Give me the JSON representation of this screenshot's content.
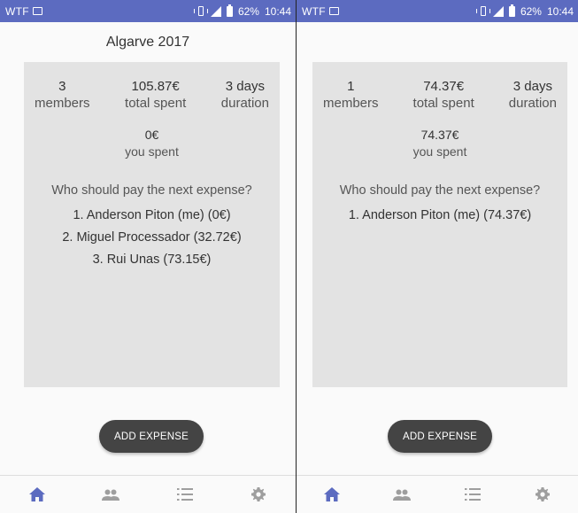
{
  "status_bar": {
    "carrier": "WTF",
    "battery": "62%",
    "time": "10:44"
  },
  "left_screen": {
    "title": "Algarve 2017",
    "stats": [
      {
        "value": "3",
        "label": "members"
      },
      {
        "value": "105.87€",
        "label": "total spent"
      },
      {
        "value": "3 days",
        "label": "duration"
      }
    ],
    "you_spent": {
      "value": "0€",
      "label": "you spent"
    },
    "question": "Who should pay the next expense?",
    "payers": [
      "1. Anderson Piton (me) (0€)",
      "2. Miguel Processador (32.72€)",
      "3. Rui Unas (73.15€)"
    ],
    "add_button": "ADD EXPENSE"
  },
  "right_screen": {
    "title": "",
    "stats": [
      {
        "value": "1",
        "label": "members"
      },
      {
        "value": "74.37€",
        "label": "total spent"
      },
      {
        "value": "3 days",
        "label": "duration"
      }
    ],
    "you_spent": {
      "value": "74.37€",
      "label": "you spent"
    },
    "question": "Who should pay the next expense?",
    "payers": [
      "1. Anderson Piton (me) (74.37€)"
    ],
    "add_button": "ADD EXPENSE"
  },
  "bottom_nav": {
    "items": [
      "home-icon",
      "people-icon",
      "list-icon",
      "settings-icon"
    ],
    "active_color": "#5c6bc0",
    "inactive_color": "#9e9e9e"
  },
  "colors": {
    "status_bar": "#5c6bc0",
    "card": "#e3e3e3",
    "button": "#444444"
  }
}
